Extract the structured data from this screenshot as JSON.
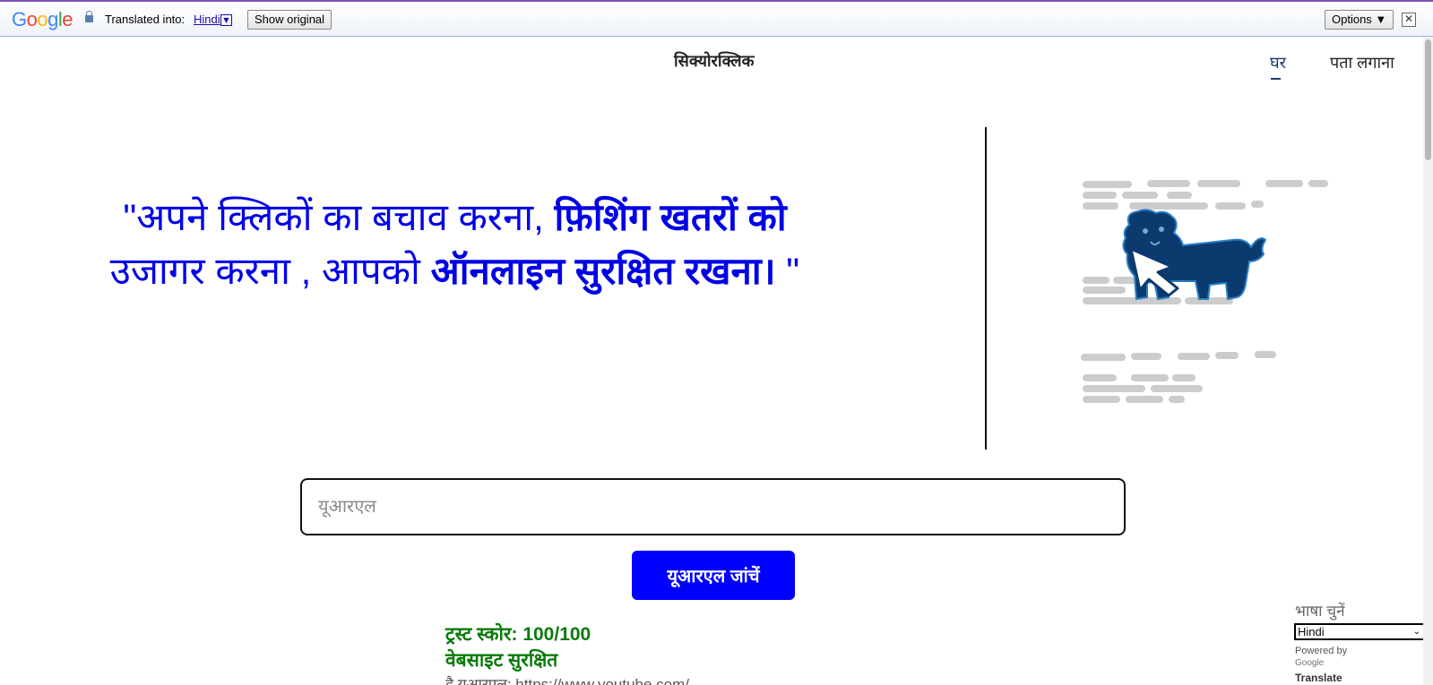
{
  "translate_bar": {
    "logo": "Google",
    "translated_into": "Translated into:",
    "language": "Hindi",
    "show_original": "Show original",
    "options": "Options ▼",
    "close": "✕"
  },
  "header": {
    "brand": "सिक्योरक्लिक",
    "nav": {
      "home": "घर",
      "detect": "पता लगाना"
    }
  },
  "hero": {
    "quote_part1": "\"अपने क्लिकों का बचाव करना, ",
    "quote_bold1": "फ़िशिंग खतरों को",
    "quote_part2": " उजागर करना , आपको ",
    "quote_bold2": "ऑनलाइन सुरक्षित रखना।",
    "quote_end": " \""
  },
  "form": {
    "url_placeholder": "यूआरएल",
    "check_button": "यूआरएल जांचें"
  },
  "result": {
    "trust_score": "ट्रस्ट स्कोर: 100/100",
    "status": "वेबसाइट सुरक्षित",
    "url_line": "है यूआरएल: https://www.youtube.com/"
  },
  "language_widget": {
    "title": "भाषा चुनें",
    "selected": "Hindi",
    "powered_by": "Powered by",
    "google": "Google",
    "translate": "Translate"
  },
  "colors": {
    "accent": "#0000ff",
    "hero_text": "#0000e6",
    "safe_green": "#0a7a0a",
    "dog": "#0a3a6e"
  },
  "icons": {
    "lock": "lock-icon",
    "close": "close-icon",
    "illustration": "dog-cursor-illustration"
  }
}
